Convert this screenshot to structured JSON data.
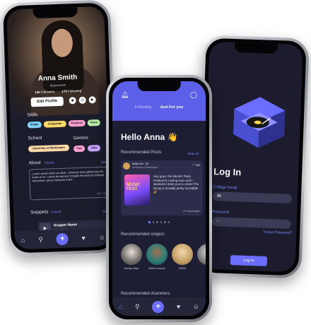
{
  "profile": {
    "name": "Anna Smith",
    "handle": "@annasmith",
    "followers_count": "10k",
    "followers_label": "Followers",
    "following_count": "170",
    "following_label": "Following",
    "edit_label": "Edit Profile",
    "singer_label": "Singer",
    "genres_label": "Genres",
    "skills_label": "Skills",
    "skills": [
      "Singer",
      "Songwriter",
      "Producer",
      "Piano"
    ],
    "school_label": "School",
    "school": "University of Washington",
    "genres": [
      "Pop",
      "Indie"
    ],
    "about_label": "About",
    "about_cancel": "Cancel",
    "about_save": "Save",
    "about_text": "Lorem ipsum dolor sit amet, consecte tural adipiscing elit. Nulla et mi. Lorem fermentum fringilla fermentum tristique fermentum genus felisuise erant",
    "about_count": "200 / 700",
    "snippets_label": "Snippets",
    "snippets_cancel": "Cancel",
    "snippets_save": "Save",
    "snippet_title": "Snippet Name",
    "snippet_artist": "Anna Smith"
  },
  "login": {
    "title": "Log In",
    "email_label": "College Email",
    "password_label": "Password",
    "forgot": "Forgot Password?",
    "button": "Log In"
  },
  "home": {
    "tabs": [
      "Following",
      "Just For you"
    ],
    "greeting": "Hello Anna 👋",
    "posts_label": "Recommended Posts",
    "view_all": "View All",
    "post_user": "Kelly Kim · 2h",
    "post_school": "University of Washington",
    "post_likes": "♡ 322",
    "post_poster": "MUSIC FEST",
    "post_text": "Hey guys, the Electric Party Festival is coming soon and I wanted to invite you to come! The lineup is actually pretty incredible 🎉",
    "post_comments": "37 comments",
    "singers_label": "Recommended singers",
    "singers": [
      "Benny Jean",
      "Bella Lorence",
      "SARA",
      "Gi"
    ],
    "drummers_label": "Recommended drummers"
  },
  "colors": {
    "accent": "#6b6dff",
    "bg": "#1d1e33",
    "header": "#5c5fe8"
  }
}
